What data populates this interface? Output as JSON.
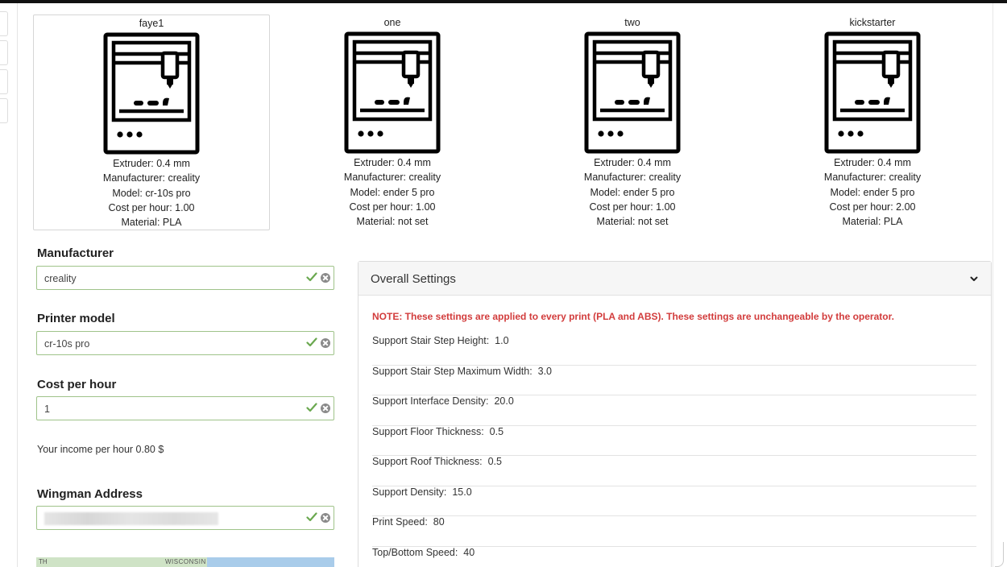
{
  "printers": [
    {
      "name": "faye1",
      "extruder": "Extruder: 0.4 mm",
      "manufacturer": "Manufacturer: creality",
      "model": "Model: cr-10s pro",
      "cost": "Cost per hour: 1.00",
      "material": "Material: PLA",
      "selected": true
    },
    {
      "name": "one",
      "extruder": "Extruder: 0.4 mm",
      "manufacturer": "Manufacturer: creality",
      "model": "Model: ender 5 pro",
      "cost": "Cost per hour: 1.00",
      "material": "Material: not set",
      "selected": false
    },
    {
      "name": "two",
      "extruder": "Extruder: 0.4 mm",
      "manufacturer": "Manufacturer: creality",
      "model": "Model: ender 5 pro",
      "cost": "Cost per hour: 1.00",
      "material": "Material: not set",
      "selected": false
    },
    {
      "name": "kickstarter",
      "extruder": "Extruder: 0.4 mm",
      "manufacturer": "Manufacturer: creality",
      "model": "Model: ender 5 pro",
      "cost": "Cost per hour: 2.00",
      "material": "Material: PLA",
      "selected": false
    }
  ],
  "form": {
    "manufacturer_label": "Manufacturer",
    "manufacturer_value": "creality",
    "model_label": "Printer model",
    "model_value": "cr-10s pro",
    "cost_label": "Cost per hour",
    "cost_value": "1",
    "income_text": "Your income per hour 0.80 $",
    "wingman_label": "Wingman Address"
  },
  "map": {
    "label_left": "TH",
    "label_state": "WISCONSIN"
  },
  "settings_panel": {
    "title": "Overall Settings",
    "note": "NOTE: These settings are applied to every print (PLA and ABS). These settings are unchangeable by the operator.",
    "rows": [
      "Support Stair Step Height:  1.0",
      "Support Stair Step Maximum Width:  3.0",
      "Support Interface Density:  20.0",
      "Support Floor Thickness:  0.5",
      "Support Roof Thickness:  0.5",
      "Support Density:  15.0",
      "Print Speed:  80",
      "Top/Bottom Speed:  40"
    ]
  },
  "colors": {
    "valid_border": "#9fc389",
    "check": "#6aa84f",
    "note": "#d23c3c"
  },
  "icons": {
    "printer": "3d-printer-icon",
    "check": "check-icon",
    "clear": "clear-icon",
    "chevron": "chevron-down-icon"
  }
}
